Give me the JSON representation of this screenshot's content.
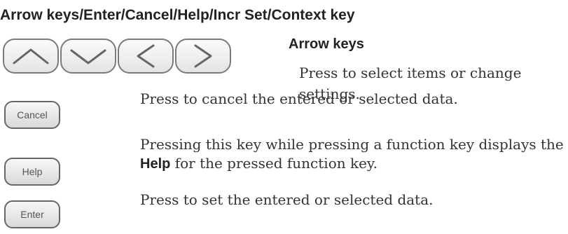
{
  "heading": "Arrow keys/Enter/Cancel/Help/Incr Set/Context key",
  "arrow_keys": {
    "title": "Arrow keys",
    "description": "Press to select items or change settings.",
    "icons": [
      "arrow-up-icon",
      "arrow-down-icon",
      "arrow-left-icon",
      "arrow-right-icon"
    ]
  },
  "keys": {
    "cancel": {
      "label": "Cancel",
      "description": "Press to cancel the entered or selected data."
    },
    "help": {
      "label": "Help",
      "description_before": "Pressing this key while pressing a function key displays the ",
      "description_bold": "Help",
      "description_after": " for the pressed function key."
    },
    "enter": {
      "label": "Enter",
      "description": "Press to set the entered or selected data."
    }
  }
}
